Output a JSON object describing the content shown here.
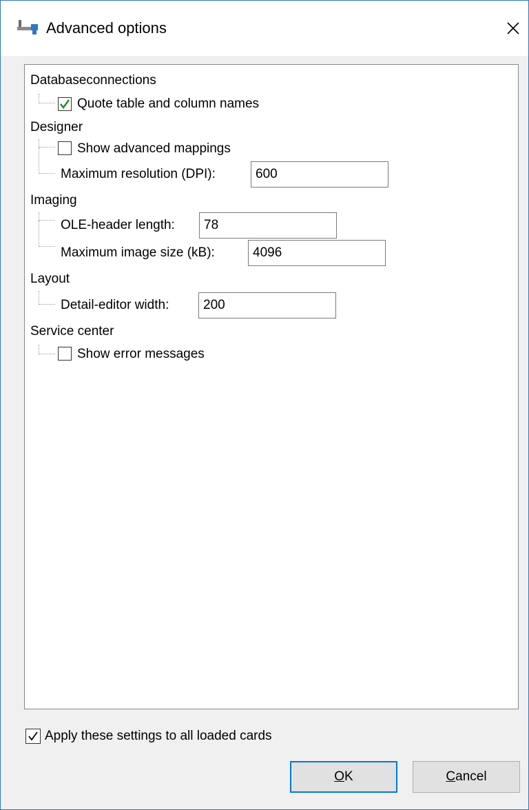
{
  "window": {
    "title": "Advanced options",
    "icon": "database-plug-icon"
  },
  "tree": {
    "categories": [
      {
        "label": "Databaseconnections",
        "items": [
          {
            "type": "checkbox",
            "label": "Quote table and column names",
            "checked": true
          }
        ]
      },
      {
        "label": "Designer",
        "items": [
          {
            "type": "checkbox",
            "label": "Show advanced mappings",
            "checked": false
          },
          {
            "type": "field",
            "label": "Maximum resolution (DPI):",
            "value": "600"
          }
        ]
      },
      {
        "label": "Imaging",
        "items": [
          {
            "type": "field",
            "label": "OLE-header length:",
            "value": "78"
          },
          {
            "type": "field",
            "label": "Maximum image size (kB):",
            "value": "4096"
          }
        ]
      },
      {
        "label": "Layout",
        "items": [
          {
            "type": "field",
            "label": "Detail-editor width:",
            "value": "200"
          }
        ]
      },
      {
        "label": "Service center",
        "items": [
          {
            "type": "checkbox",
            "label": "Show error messages",
            "checked": false
          }
        ]
      }
    ]
  },
  "footer": {
    "apply_label": "Apply these settings to all loaded cards",
    "apply_checked": true,
    "ok_accel": "O",
    "ok_rest": "K",
    "cancel_accel": "C",
    "cancel_rest": "ancel"
  },
  "colors": {
    "check_green": "#1e8c1e",
    "window_border": "#2b79c2",
    "default_button_border": "#0078d7"
  }
}
